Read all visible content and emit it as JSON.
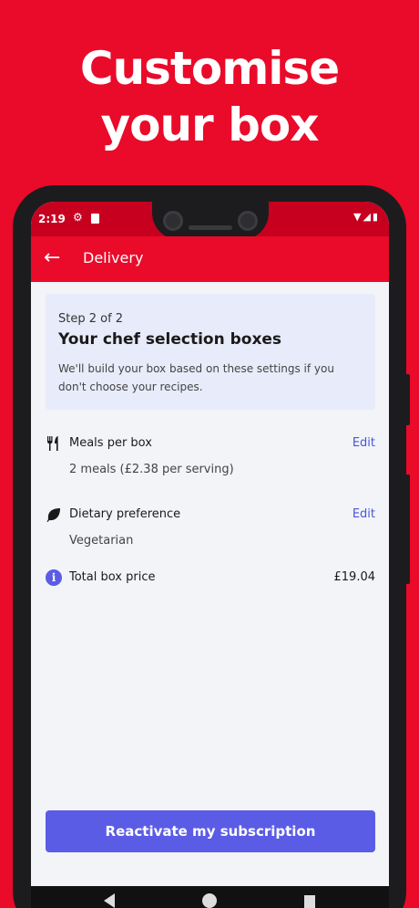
{
  "promo": {
    "headline_line1": "Customise",
    "headline_line2": "your box"
  },
  "status_bar": {
    "time": "2:19"
  },
  "app_bar": {
    "title": "Delivery"
  },
  "step_card": {
    "step_label": "Step 2 of 2",
    "title": "Your chef selection boxes",
    "description": "We'll build your box based on these settings if you don't choose your recipes."
  },
  "meals": {
    "title": "Meals per box",
    "value": "2 meals (£2.38 per serving)",
    "edit_label": "Edit",
    "icon": "fork-knife-icon"
  },
  "dietary": {
    "title": "Dietary preference",
    "value": "Vegetarian",
    "edit_label": "Edit",
    "icon": "leaf-icon"
  },
  "total": {
    "title": "Total box price",
    "value": "£19.04",
    "icon": "info-icon"
  },
  "cta": {
    "label": "Reactivate my subscription"
  },
  "colors": {
    "brand_red": "#ea0a2a",
    "accent_purple": "#5b5ce6",
    "card_bg": "#e8ecfa"
  }
}
